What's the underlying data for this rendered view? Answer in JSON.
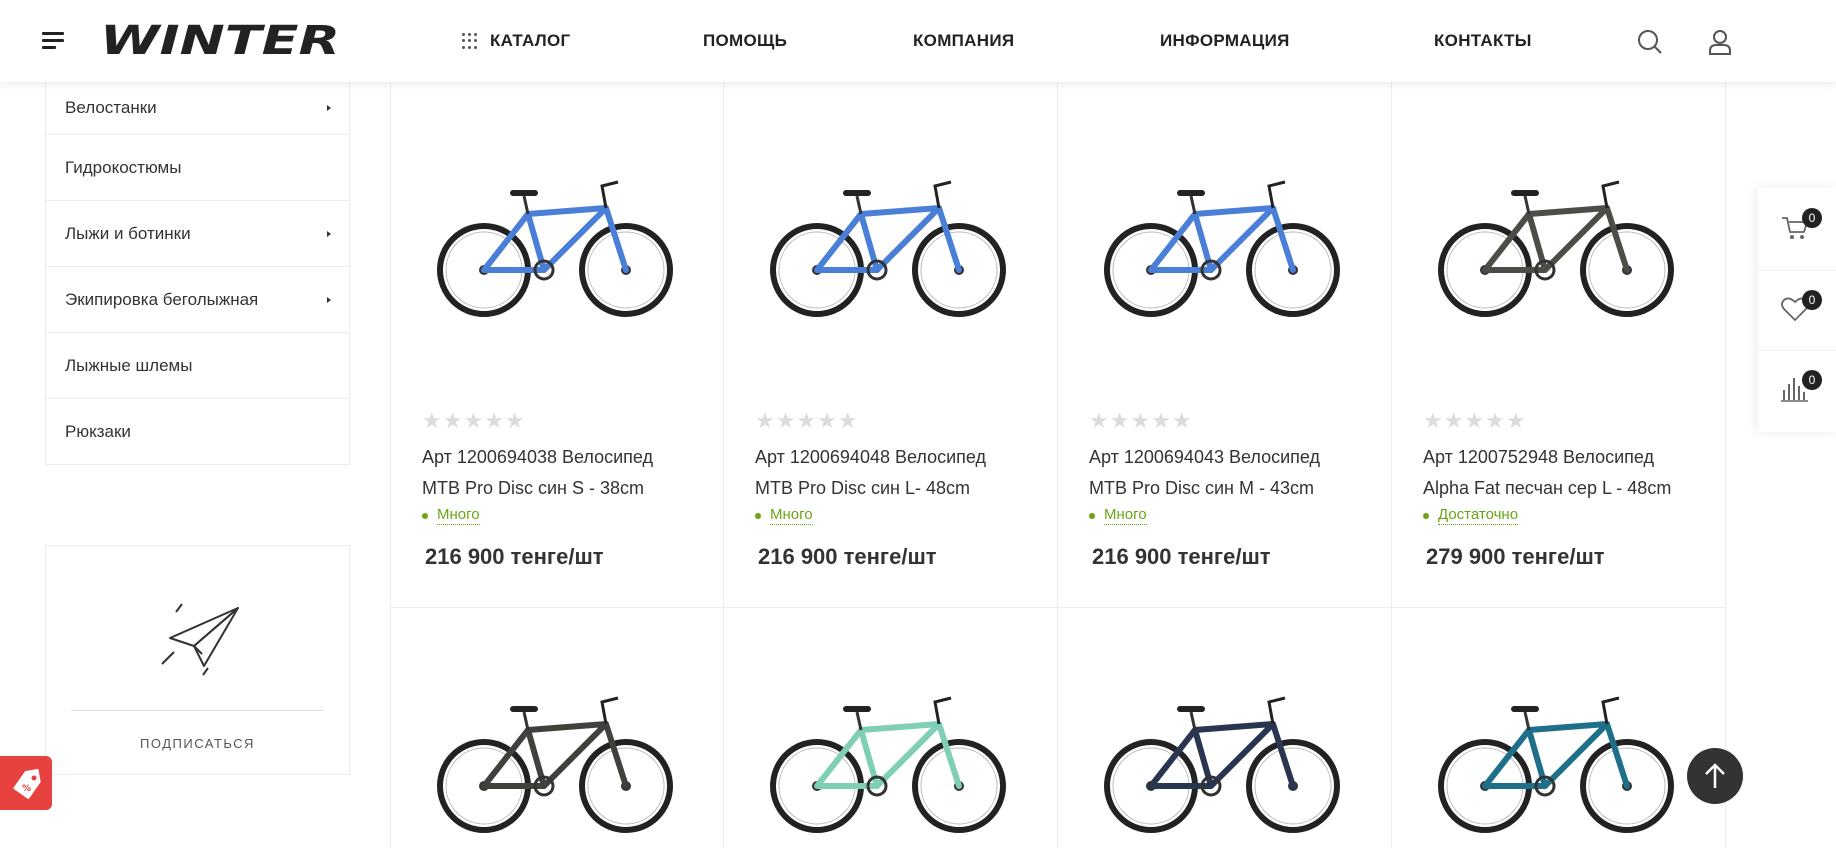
{
  "header": {
    "brand": "WINTER",
    "nav": {
      "catalog": "КАТАЛОГ",
      "help": "ПОМОЩЬ",
      "company": "КОМПАНИЯ",
      "info": "ИНФОРМАЦИЯ",
      "contacts": "КОНТАКТЫ"
    }
  },
  "sidebar": {
    "items": [
      {
        "label": "Велостанки",
        "has_children": true
      },
      {
        "label": "Гидрокостюмы",
        "has_children": false
      },
      {
        "label": "Лыжи и ботинки",
        "has_children": true
      },
      {
        "label": "Экипировка беголыжная",
        "has_children": true
      },
      {
        "label": "Лыжные шлемы",
        "has_children": false
      },
      {
        "label": "Рюкзаки",
        "has_children": false
      }
    ],
    "subscribe_label": "ПОДПИСАТЬСЯ"
  },
  "products": [
    {
      "title_line1": "Арт 1200694038 Велосипед",
      "title_line2": "MTB Pro Disc син S - 38cm",
      "stock": "Много",
      "price": "216 900 тенге/шт",
      "bike_color": "#4a7fd8",
      "rating": 0
    },
    {
      "title_line1": "Арт 1200694048 Велосипед",
      "title_line2": "MTB Pro Disc син L- 48cm",
      "stock": "Много",
      "price": "216 900 тенге/шт",
      "bike_color": "#4a7fd8",
      "rating": 0
    },
    {
      "title_line1": "Арт 1200694043 Велосипед",
      "title_line2": "MTB Pro Disc син M - 43cm",
      "stock": "Много",
      "price": "216 900 тенге/шт",
      "bike_color": "#4a7fd8",
      "rating": 0
    },
    {
      "title_line1": "Арт 1200752948 Велосипед",
      "title_line2": "Alpha Fat песчан сер L - 48cm",
      "stock": "Достаточно",
      "price": "279 900 тенге/шт",
      "bike_color": "#4b4e47",
      "rating": 0
    }
  ],
  "products_row2": [
    {
      "bike_color": "#3f423c"
    },
    {
      "bike_color": "#7ecfb5"
    },
    {
      "bike_color": "#2a3550"
    },
    {
      "bike_color": "#1e6f8a"
    }
  ],
  "float_panel": {
    "cart_count": "0",
    "favorites_count": "0",
    "compare_count": "0"
  },
  "colors": {
    "accent_green": "#6aa516",
    "promo_red": "#e7423f",
    "dark": "#333333"
  }
}
